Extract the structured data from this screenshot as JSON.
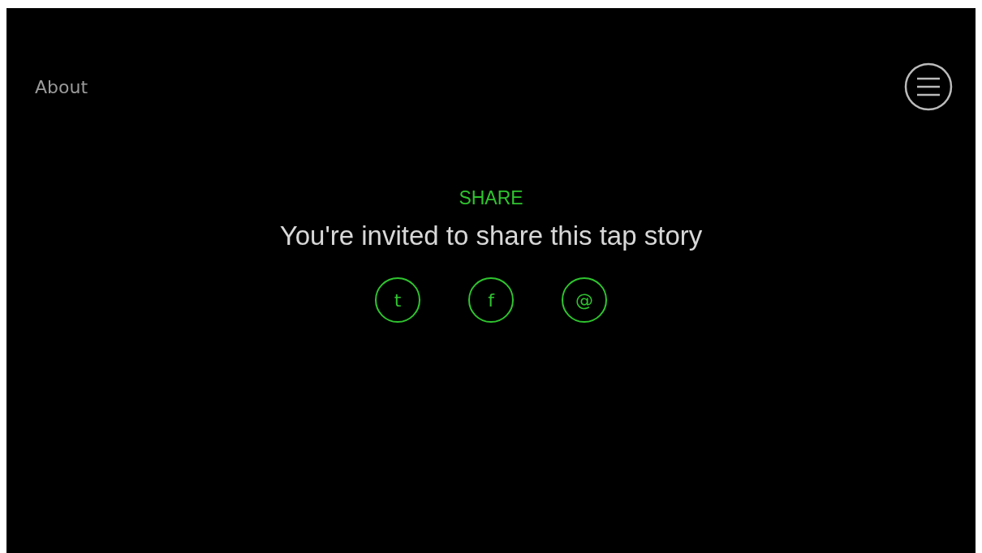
{
  "header": {
    "about_link": "About"
  },
  "share": {
    "heading": "SHARE",
    "message": "You're invited to share this tap story",
    "buttons": [
      {
        "label": "t"
      },
      {
        "label": "f"
      },
      {
        "label": "@"
      }
    ]
  }
}
